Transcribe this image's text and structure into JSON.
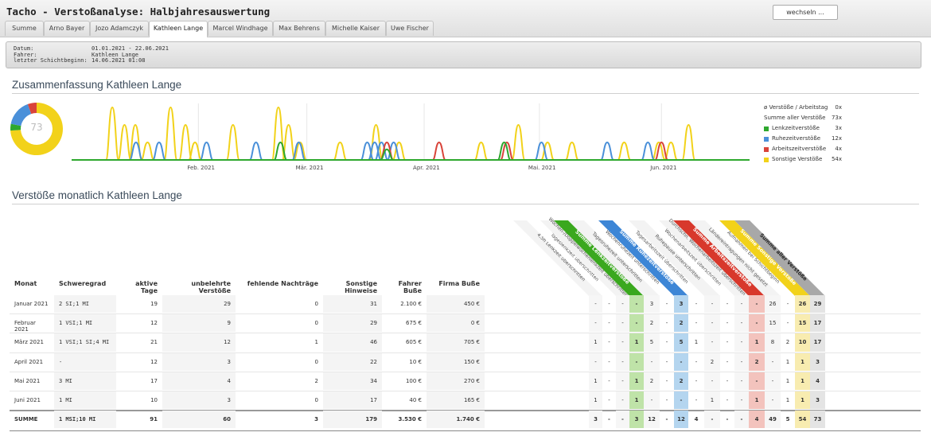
{
  "window": {
    "title": "Tacho - Verstoßanalyse: Halbjahresauswertung",
    "switch_label": "wechseln ..."
  },
  "tabs": [
    "Summe",
    "Arno Bayer",
    "Jozo Adamczyk",
    "Kathleen Lange",
    "Marcel Windhage",
    "Max Behrens",
    "Michelle Kaiser",
    "Uwe Fischer"
  ],
  "active_tab": "Kathleen Lange",
  "info": {
    "labels": [
      "Datum:",
      "Fahrer:",
      "letzter Schichtbeginn:"
    ],
    "values": [
      "01.01.2021 - 22.06.2021",
      "Kathleen Lange",
      "14.06.2021 01:08"
    ]
  },
  "summary": {
    "heading": "Zusammenfassung Kathleen Lange",
    "donut_total": "73",
    "legend": [
      {
        "label": "ø Verstöße / Arbeitstag",
        "value": "0x",
        "color": null
      },
      {
        "label": "Summe aller Verstöße",
        "value": "73x",
        "color": null
      },
      {
        "label": "Lenkzeitverstöße",
        "value": "3x",
        "color": "#2ea82e"
      },
      {
        "label": "Ruhezeitverstöße",
        "value": "12x",
        "color": "#4a90d9"
      },
      {
        "label": "Arbeitszeitverstöße",
        "value": "4x",
        "color": "#d9443a"
      },
      {
        "label": "Sonstige Verstöße",
        "value": "54x",
        "color": "#f2d21a"
      }
    ],
    "months": [
      "Feb. 2021",
      "Mär. 2021",
      "Apr. 2021",
      "Mai. 2021",
      "Jun. 2021"
    ]
  },
  "chart_data": {
    "type": "line",
    "series": [
      {
        "name": "Sonstige Verstöße",
        "color": "#f2d21a",
        "events": [
          [
            0.06,
            3
          ],
          [
            0.078,
            2
          ],
          [
            0.094,
            2
          ],
          [
            0.112,
            1
          ],
          [
            0.146,
            3
          ],
          [
            0.168,
            2
          ],
          [
            0.182,
            1
          ],
          [
            0.238,
            2
          ],
          [
            0.305,
            3
          ],
          [
            0.32,
            2
          ],
          [
            0.337,
            1
          ],
          [
            0.396,
            1
          ],
          [
            0.449,
            2
          ],
          [
            0.483,
            1
          ],
          [
            0.604,
            1
          ],
          [
            0.659,
            2
          ],
          [
            0.702,
            1
          ],
          [
            0.738,
            1
          ],
          [
            0.815,
            1
          ],
          [
            0.866,
            1
          ],
          [
            0.884,
            1
          ],
          [
            0.91,
            2
          ]
        ]
      },
      {
        "name": "Ruhezeitverstöße",
        "color": "#4a90d9",
        "events": [
          [
            0.095,
            1
          ],
          [
            0.129,
            1
          ],
          [
            0.199,
            1
          ],
          [
            0.272,
            1
          ],
          [
            0.335,
            1
          ],
          [
            0.436,
            1
          ],
          [
            0.447,
            1
          ],
          [
            0.457,
            1
          ],
          [
            0.475,
            1
          ],
          [
            0.693,
            1
          ],
          [
            0.79,
            1
          ],
          [
            0.85,
            1
          ]
        ]
      },
      {
        "name": "Arbeitszeitverstöße",
        "color": "#d9443a",
        "events": [
          [
            0.465,
            1
          ],
          [
            0.542,
            1
          ],
          [
            0.642,
            1
          ],
          [
            0.87,
            1
          ]
        ]
      },
      {
        "name": "Lenkzeitverstöße",
        "color": "#2ea82e",
        "events": [
          [
            0.308,
            1
          ],
          [
            0.465,
            0.6
          ],
          [
            0.638,
            1
          ]
        ]
      }
    ],
    "donut": [
      {
        "name": "Sonstige Verstöße",
        "value": 54,
        "color": "#f2d21a"
      },
      {
        "name": "Lenkzeitverstöße",
        "value": 3,
        "color": "#2ea82e"
      },
      {
        "name": "Ruhezeitverstöße",
        "value": 12,
        "color": "#4a90d9"
      },
      {
        "name": "Arbeitszeitverstöße",
        "value": 4,
        "color": "#d9443a"
      }
    ]
  },
  "monthly": {
    "heading": "Verstöße monatlich Kathleen Lange",
    "columns": [
      "Monat",
      "Schweregrad",
      "aktive Tage",
      "unbelehrte Verstöße",
      "fehlende Nachträge",
      "Sonstige Hinweise",
      "Fahrer Buße",
      "Firma Buße"
    ],
    "diag_headers": [
      {
        "label": "4,5h Lenkzeit überschritten",
        "type": "grey"
      },
      {
        "label": "Tageslenkzeit überschritten",
        "type": "grey"
      },
      {
        "label": "Wochen-/Doppelwochenlenkzeit überschritten",
        "type": "grey"
      },
      {
        "label": "Summe Lenkzeitverstöße",
        "type": "sum",
        "color": "#3aa81e",
        "light": "#bfe3a8"
      },
      {
        "label": "Tagesruhezeit unterschritten",
        "type": "grey"
      },
      {
        "label": "Wochenruhezeit unterschritten",
        "type": "grey"
      },
      {
        "label": "Summe Ruhezeitverstöße",
        "type": "sum",
        "color": "#3d86d6",
        "light": "#b4d5ef"
      },
      {
        "label": "Tagesarbeitszeit überschritten",
        "type": "grey"
      },
      {
        "label": "Ruhepause unterschritten",
        "type": "grey"
      },
      {
        "label": "Wochenarbeitszeit überschritten",
        "type": "grey"
      },
      {
        "label": "Durchschn. Wochenarbeitszeit überschritten",
        "type": "grey"
      },
      {
        "label": "Summe Arbeitszeitverstöße",
        "type": "sum",
        "color": "#d8382c",
        "light": "#f3c3bd"
      },
      {
        "label": "Ländereintragungen nicht gesetzt",
        "type": "grey"
      },
      {
        "label": "Aufnahmen bei Schichtbeginn",
        "type": "grey"
      },
      {
        "label": "Summe Sonstige Verstöße",
        "type": "sum",
        "color": "#f2d21a",
        "light": "#f8ecb0"
      },
      {
        "label": "Summe aller Verstöße",
        "type": "total",
        "color": "#a8a8a8",
        "light": "#e4e4e4"
      }
    ],
    "rows": [
      {
        "monat": "Januar 2021",
        "schwere": "2 SI;1 MI",
        "tage": "19",
        "unbelehrt": "29",
        "fehlend": "0",
        "hinweise": "31",
        "fahrer": "2.100 €",
        "firma": "450 €",
        "v": [
          "-",
          "-",
          "-",
          "-",
          "3",
          "-",
          "3",
          "-",
          "-",
          "-",
          "-",
          "-",
          "26",
          "-",
          "26",
          "29"
        ]
      },
      {
        "monat": "Februar 2021",
        "schwere": "1 VSI;1 MI",
        "tage": "12",
        "unbelehrt": "9",
        "fehlend": "0",
        "hinweise": "29",
        "fahrer": "675 €",
        "firma": "0 €",
        "v": [
          "-",
          "-",
          "-",
          "-",
          "2",
          "-",
          "2",
          "-",
          "-",
          "-",
          "-",
          "-",
          "15",
          "-",
          "15",
          "17"
        ]
      },
      {
        "monat": "März 2021",
        "schwere": "1 VSI;1 SI;4 MI",
        "tage": "21",
        "unbelehrt": "12",
        "fehlend": "1",
        "hinweise": "46",
        "fahrer": "605 €",
        "firma": "705 €",
        "v": [
          "1",
          "-",
          "-",
          "1",
          "5",
          "-",
          "5",
          "1",
          "-",
          "-",
          "-",
          "1",
          "8",
          "2",
          "10",
          "17"
        ]
      },
      {
        "monat": "April 2021",
        "schwere": "-",
        "tage": "12",
        "unbelehrt": "3",
        "fehlend": "0",
        "hinweise": "22",
        "fahrer": "10 €",
        "firma": "150 €",
        "v": [
          "-",
          "-",
          "-",
          "-",
          "-",
          "-",
          "-",
          "-",
          "2",
          "-",
          "-",
          "2",
          "-",
          "1",
          "1",
          "3"
        ]
      },
      {
        "monat": "Mai 2021",
        "schwere": "3 MI",
        "tage": "17",
        "unbelehrt": "4",
        "fehlend": "2",
        "hinweise": "34",
        "fahrer": "100 €",
        "firma": "270 €",
        "v": [
          "1",
          "-",
          "-",
          "1",
          "2",
          "-",
          "2",
          "-",
          "-",
          "-",
          "-",
          "-",
          "-",
          "1",
          "1",
          "4"
        ]
      },
      {
        "monat": "Juni 2021",
        "schwere": "1 MI",
        "tage": "10",
        "unbelehrt": "3",
        "fehlend": "0",
        "hinweise": "17",
        "fahrer": "40 €",
        "firma": "165 €",
        "v": [
          "1",
          "-",
          "-",
          "1",
          "-",
          "-",
          "-",
          "-",
          "1",
          "-",
          "-",
          "1",
          "-",
          "1",
          "1",
          "3"
        ]
      }
    ],
    "sum": {
      "monat": "SUMME",
      "schwere": "1 MSI;10 MI",
      "tage": "91",
      "unbelehrt": "60",
      "fehlend": "3",
      "hinweise": "179",
      "fahrer": "3.530 €",
      "firma": "1.740 €",
      "v": [
        "3",
        "-",
        "-",
        "3",
        "12",
        "-",
        "12",
        "4",
        "-",
        "-",
        "-",
        "4",
        "49",
        "5",
        "54",
        "73"
      ]
    }
  }
}
